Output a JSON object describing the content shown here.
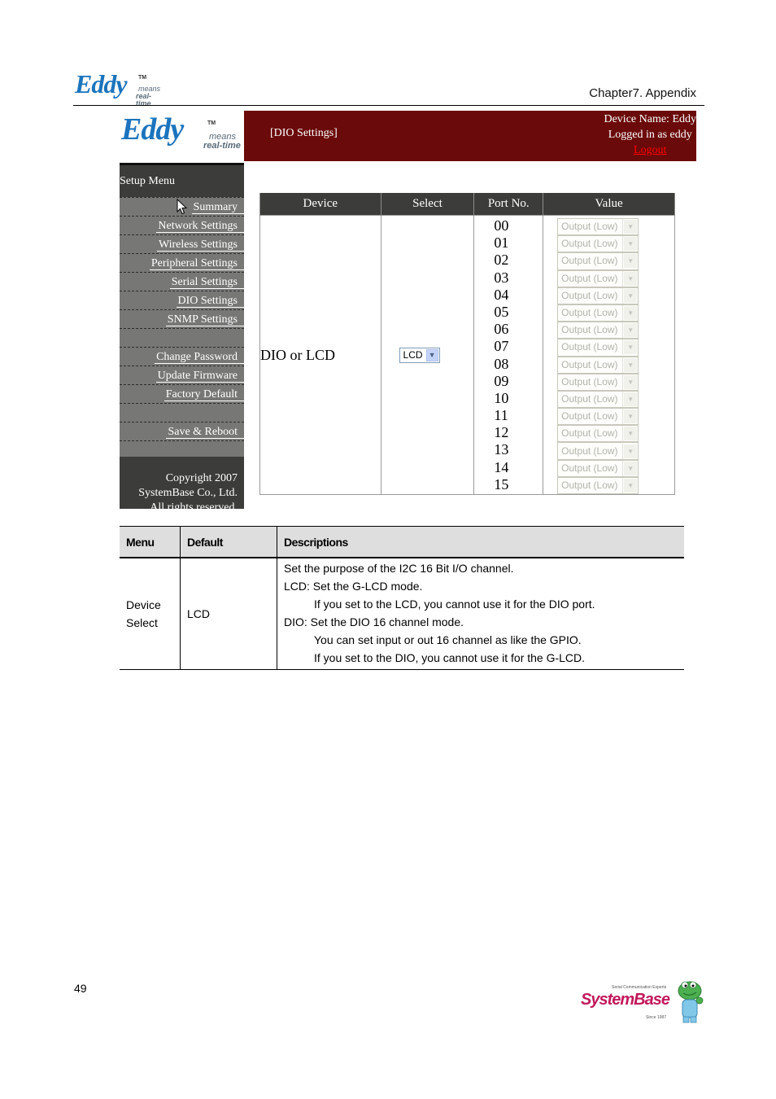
{
  "document": {
    "header_logo": {
      "word": "Eddy",
      "tm": "TM",
      "tagline_1": "means",
      "tagline_2": "real-time"
    },
    "chapter": "Chapter7. Appendix",
    "page_number": "49",
    "footer_logo": {
      "tagline": "Serial Communication Experts",
      "word": "SystemBase",
      "since": "Since 1987"
    }
  },
  "ui": {
    "logo": {
      "word": "Eddy",
      "tm": "TM",
      "tagline_1": "means",
      "tagline_2": "real-time"
    },
    "page_title": "[DIO Settings]",
    "device_name": "Device Name: Eddy",
    "logged_in": "Logged in as eddy",
    "logout": "Logout",
    "sidebar": {
      "heading": "Setup Menu",
      "items": [
        {
          "label": "Summary"
        },
        {
          "label": "Network Settings"
        },
        {
          "label": "Wireless Settings"
        },
        {
          "label": "Peripheral Settings"
        },
        {
          "label": "Serial Settings"
        },
        {
          "label": "DIO Settings"
        },
        {
          "label": "SNMP Settings"
        },
        {
          "label": ""
        },
        {
          "label": "Change Password"
        },
        {
          "label": "Update Firmware"
        },
        {
          "label": "Factory Default"
        },
        {
          "label": ""
        },
        {
          "label": "Save & Reboot"
        }
      ],
      "copyright": [
        "Copyright 2007",
        "SystemBase Co., Ltd.",
        "All rights reserved."
      ]
    },
    "table": {
      "headers": [
        "Device",
        "Select",
        "Port No.",
        "Value"
      ],
      "device_label": "DIO or LCD",
      "select_value": "LCD",
      "ports": [
        "00",
        "01",
        "02",
        "03",
        "04",
        "05",
        "06",
        "07",
        "08",
        "09",
        "10",
        "11",
        "12",
        "13",
        "14",
        "15"
      ],
      "port_value": "Output (Low)"
    }
  },
  "desc_table": {
    "headers": [
      "Menu",
      "Default",
      "Descriptions"
    ],
    "rows": [
      {
        "menu_1": "Device",
        "menu_2": "Select",
        "default": "LCD",
        "lines": [
          "Set the purpose of the I2C 16 Bit I/O channel.",
          "LCD: Set the G-LCD mode.",
          "If you set to the LCD, you cannot use it for the DIO port.",
          "DIO: Set the DIO 16 channel mode.",
          "You can set input or out 16 channel as like the GPIO.",
          "If you set to the DIO, you cannot use it for the G-LCD."
        ]
      }
    ]
  },
  "colors": {
    "banner": "#6b0a0a",
    "sidebar": "#777876",
    "sidebar_dark": "#3c3d3b",
    "logout": "#ff0000",
    "eddy_blue": "#1b74bd"
  }
}
